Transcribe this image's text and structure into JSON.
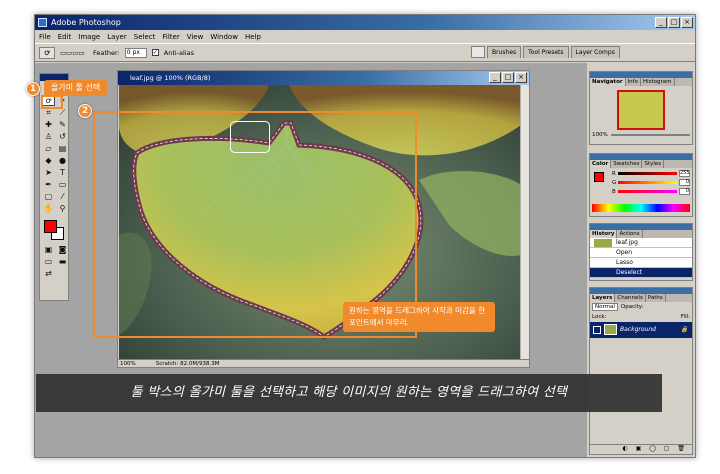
{
  "app": {
    "title": "Adobe Photoshop"
  },
  "menu": [
    "File",
    "Edit",
    "Image",
    "Layer",
    "Select",
    "Filter",
    "View",
    "Window",
    "Help"
  ],
  "options": {
    "feather_label": "Feather:",
    "feather_value": "0 px",
    "antialias_label": "Anti-alias",
    "palette_tabs": [
      "Brushes",
      "Tool Presets",
      "Layer Comps"
    ]
  },
  "document": {
    "title": "leaf.jpg @ 100% (RGB/8)",
    "zoom": "100%",
    "scratch": "Scratch: 82.0M/938.3M"
  },
  "callouts": {
    "step1_number": "1",
    "step1_text": "올가미 툴 선택",
    "step2_number": "2",
    "step2_text": "원하는 영역을 드래그하여 시작과 마감을 한 포인트에서 마무리."
  },
  "panels": {
    "navigator": {
      "tabs": [
        "Navigator",
        "Info",
        "Histogram"
      ],
      "zoom": "100%"
    },
    "color": {
      "tabs": [
        "Color",
        "Swatches",
        "Styles"
      ],
      "channels": [
        {
          "label": "R",
          "value": "255"
        },
        {
          "label": "G",
          "value": "0"
        },
        {
          "label": "B",
          "value": "0"
        }
      ]
    },
    "history": {
      "tabs": [
        "History",
        "Actions"
      ],
      "snapshot": "leaf.jpg",
      "items": [
        "Open",
        "Lasso",
        "Deselect"
      ]
    },
    "layers": {
      "tabs": [
        "Layers",
        "Channels",
        "Paths"
      ],
      "blend_mode": "Normal",
      "opacity_label": "Opacity:",
      "lock_label": "Lock:",
      "fill_label": "Fill:",
      "layer_name": "Background"
    }
  },
  "caption": "툴 박스의 올가미 툴을 선택하고 해당 이미지의 원하는 영역을 드래그하여 선택",
  "colors": {
    "accent": "#f08a2c",
    "foreground": "#ff0000",
    "background": "#ffffff",
    "titlebar": "#0a246a"
  }
}
